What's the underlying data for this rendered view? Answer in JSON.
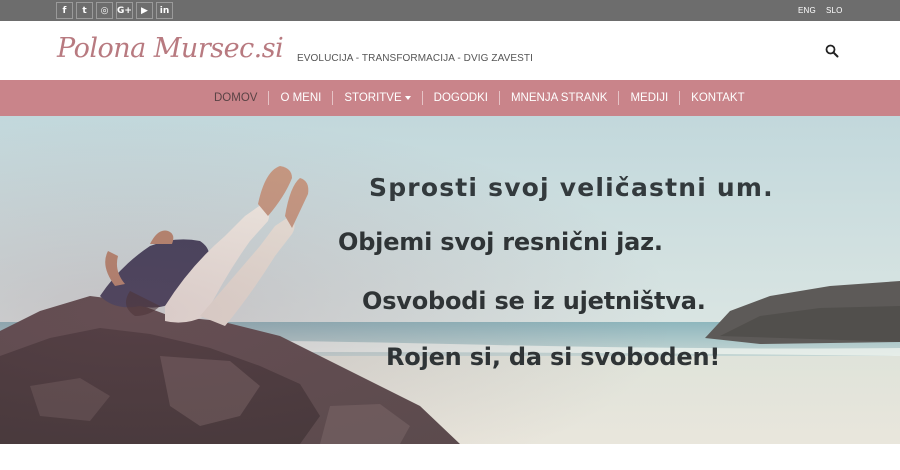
{
  "topbar": {
    "social": [
      {
        "icon": "facebook-icon",
        "glyph": "f"
      },
      {
        "icon": "twitter-icon",
        "glyph": "t"
      },
      {
        "icon": "instagram-icon",
        "glyph": "◎"
      },
      {
        "icon": "google-plus-icon",
        "glyph": "G+"
      },
      {
        "icon": "youtube-icon",
        "glyph": "▶"
      },
      {
        "icon": "linkedin-icon",
        "glyph": "in"
      }
    ],
    "lang_eng": "ENG",
    "lang_slo": "SLO"
  },
  "header": {
    "logo": "Polona Mursec.si",
    "tagline": "EVOLUCIJA - TRANSFORMACIJA - DVIG ZAVESTI",
    "search_icon": "search-icon"
  },
  "nav": {
    "items": [
      {
        "label": "DOMOV",
        "active": true
      },
      {
        "label": "O MENI"
      },
      {
        "label": "STORITVE",
        "dropdown": true
      },
      {
        "label": "DOGODKI"
      },
      {
        "label": "MNENJA STRANK"
      },
      {
        "label": "MEDIJI"
      },
      {
        "label": "KONTAKT"
      }
    ]
  },
  "hero": {
    "line1": "Sprosti svoj veličastni um.",
    "line2": "Objemi svoj resnični jaz.",
    "line3": "Osvobodi se iz ujetništva.",
    "line4": "Rojen si, da si svoboden!"
  },
  "colors": {
    "topbar": "#6d6d6d",
    "nav": "#c9848a",
    "logo": "#b87a80"
  }
}
